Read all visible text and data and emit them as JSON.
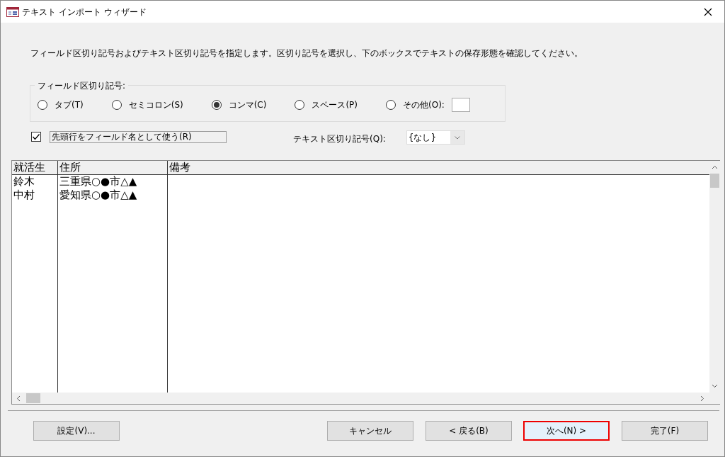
{
  "window": {
    "title": "テキスト インポート ウィザード"
  },
  "instruction": "フィールド区切り記号およびテキスト区切り記号を指定します。区切り記号を選択し、下のボックスでテキストの保存形態を確認してください。",
  "field_delimiter": {
    "legend": "フィールド区切り記号:",
    "options": [
      {
        "label": "タブ(T)",
        "selected": false
      },
      {
        "label": "セミコロン(S)",
        "selected": false
      },
      {
        "label": "コンマ(C)",
        "selected": true
      },
      {
        "label": "スペース(P)",
        "selected": false
      },
      {
        "label": "その他(O):",
        "selected": false
      }
    ]
  },
  "first_row_names": {
    "label": "先頭行をフィールド名として使う(R)",
    "checked": true
  },
  "text_qualifier": {
    "label": "テキスト区切り記号(Q):",
    "value": "{なし}"
  },
  "table": {
    "columns": [
      "就活生",
      "住所",
      "備考"
    ],
    "rows": [
      [
        "鈴木",
        "三重県○●市△▲",
        ""
      ],
      [
        "中村",
        "愛知県○●市△▲",
        ""
      ]
    ]
  },
  "buttons": [
    {
      "label": "設定(V)...",
      "focused": false
    },
    {
      "label": "キャンセル",
      "focused": false
    },
    {
      "label": "< 戻る(B)",
      "focused": false
    },
    {
      "label": "次へ(N) >",
      "focused": true
    },
    {
      "label": "完了(F)",
      "focused": false
    }
  ]
}
